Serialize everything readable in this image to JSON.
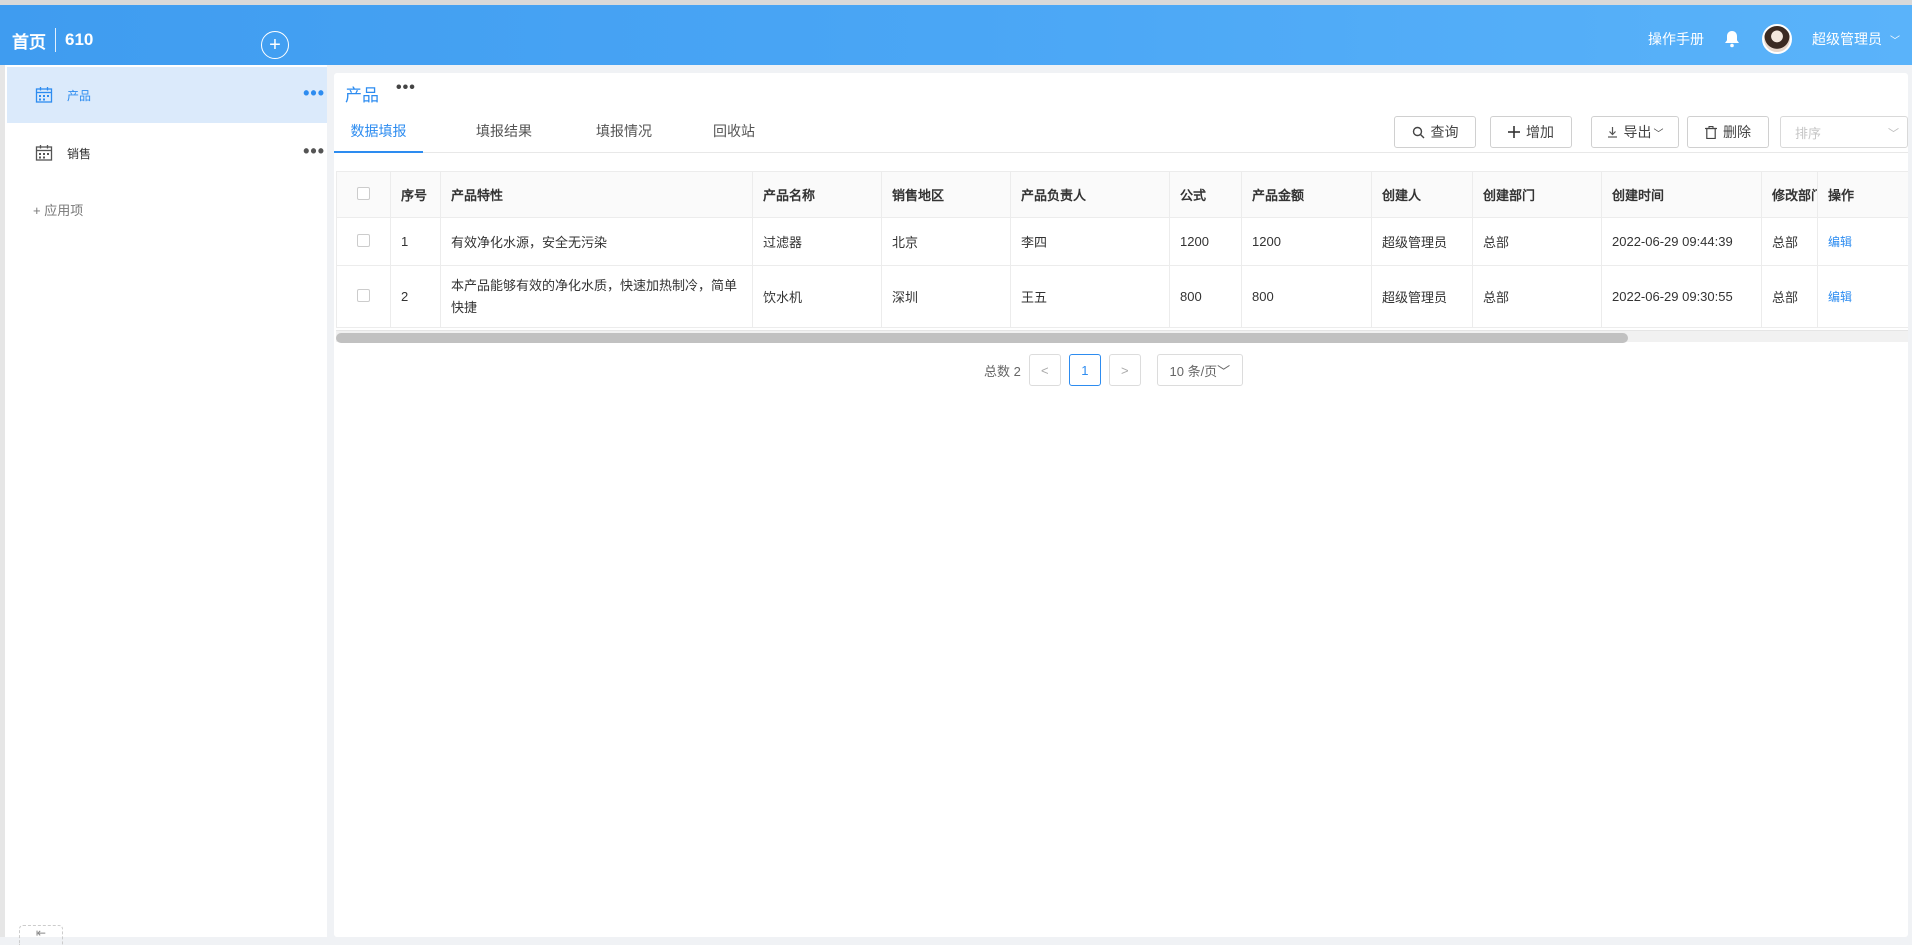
{
  "header": {
    "home": "首页",
    "app_id": "610",
    "add_symbol": "+",
    "manual": "操作手册",
    "username": "超级管理员",
    "caret": "﹀"
  },
  "sidebar": {
    "items": [
      {
        "label": "产品",
        "more": "•••",
        "active": true
      },
      {
        "label": "销售",
        "more": "•••",
        "active": false
      }
    ],
    "add_app": "+ 应用项",
    "collapse": "⇤"
  },
  "main": {
    "title": "产品",
    "title_more": "•••",
    "tabs": [
      "数据填报",
      "填报结果",
      "填报情况",
      "回收站"
    ],
    "buttons": {
      "query": "查询",
      "add": "增加",
      "export": "导出",
      "delete": "删除"
    },
    "sort_placeholder": "排序"
  },
  "table": {
    "columns": [
      "序号",
      "产品特性",
      "产品名称",
      "销售地区",
      "产品负责人",
      "公式",
      "产品金额",
      "创建人",
      "创建部门",
      "创建时间",
      "修改部门",
      "操作"
    ],
    "rows": [
      {
        "no": "1",
        "feature": "有效净化水源，安全无污染",
        "name": "过滤器",
        "region": "北京",
        "owner": "李四",
        "formula": "1200",
        "amount": "1200",
        "creator": "超级管理员",
        "dept": "总部",
        "time": "2022-06-29 09:44:39",
        "mod_dept": "总部",
        "action": "编辑"
      },
      {
        "no": "2",
        "feature": "本产品能够有效的净化水质，快速加热制冷，简单快捷",
        "name": "饮水机",
        "region": "深圳",
        "owner": "王五",
        "formula": "800",
        "amount": "800",
        "creator": "超级管理员",
        "dept": "总部",
        "time": "2022-06-29 09:30:55",
        "mod_dept": "总部",
        "action": "编辑"
      }
    ]
  },
  "pagination": {
    "total": "总数 2",
    "prev": "<",
    "current": "1",
    "next": ">",
    "page_size": "10 条/页﹀"
  },
  "colors": {
    "accent": "#2d8cf0",
    "header_from": "#3f9cf0",
    "header_to": "#5ab3fa",
    "active_row": "#dbeafb"
  }
}
